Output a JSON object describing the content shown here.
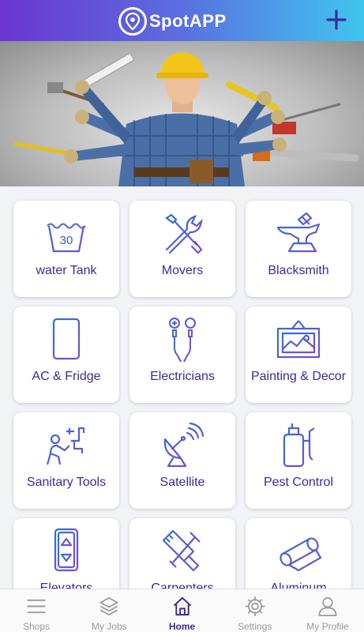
{
  "header": {
    "app_name": "SpotAPP",
    "add_icon": "plus-icon",
    "logo_icon": "location-pin-icon"
  },
  "banner": {
    "image": "handyman-with-many-arms-holding-tools"
  },
  "categories": [
    {
      "label": "water Tank",
      "icon": "water-tank-icon",
      "icon_text": "30"
    },
    {
      "label": "Movers",
      "icon": "wrench-screwdriver-icon"
    },
    {
      "label": "Blacksmith",
      "icon": "anvil-icon"
    },
    {
      "label": "AC & Fridge",
      "icon": "fridge-icon"
    },
    {
      "label": "Electricians",
      "icon": "electric-wires-icon"
    },
    {
      "label": "Painting & Decor",
      "icon": "painting-icon"
    },
    {
      "label": "Sanitary Tools",
      "icon": "plumber-icon"
    },
    {
      "label": "Satellite",
      "icon": "satellite-dish-icon"
    },
    {
      "label": "Pest Control",
      "icon": "sprayer-icon"
    },
    {
      "label": "Elevators",
      "icon": "elevator-icon"
    },
    {
      "label": "Carpenters",
      "icon": "carpentry-tools-icon"
    },
    {
      "label": "Aluminum",
      "icon": "aluminum-roll-icon"
    }
  ],
  "tabbar": {
    "tabs": [
      {
        "label": "Shops",
        "icon": "menu-icon"
      },
      {
        "label": "My Jobs",
        "icon": "layers-icon"
      },
      {
        "label": "Home",
        "icon": "home-icon",
        "active": true
      },
      {
        "label": "Settings",
        "icon": "gear-icon"
      },
      {
        "label": "My Profile",
        "icon": "user-icon"
      }
    ]
  },
  "colors": {
    "header_gradient": [
      "#6a35d0",
      "#5b6fe0",
      "#3fc6ef"
    ],
    "accent": "#3b2a9a",
    "icon_gradient": [
      "#2f6fd6",
      "#7b4bd8"
    ]
  }
}
